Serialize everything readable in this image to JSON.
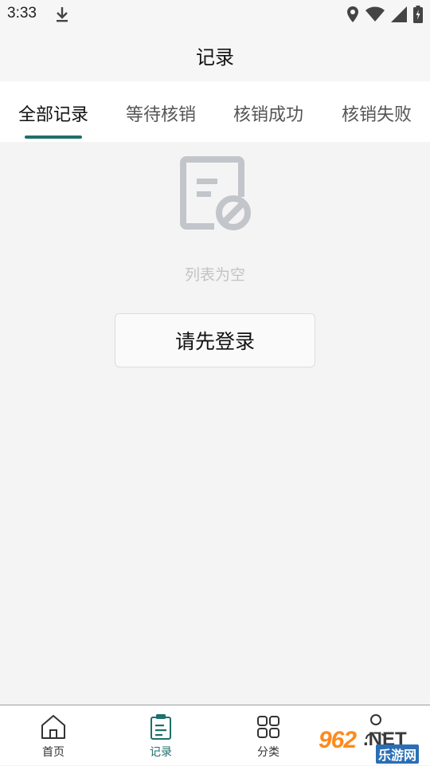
{
  "status_bar": {
    "time": "3:33"
  },
  "header": {
    "title": "记录"
  },
  "tabs": [
    {
      "label": "全部记录",
      "active": true
    },
    {
      "label": "等待核销",
      "active": false
    },
    {
      "label": "核销成功",
      "active": false
    },
    {
      "label": "核销失败",
      "active": false
    }
  ],
  "empty_state": {
    "text": "列表为空",
    "icon": "empty-document-icon"
  },
  "login_button": {
    "label": "请先登录"
  },
  "bottom_nav": [
    {
      "label": "首页",
      "icon": "home-icon",
      "active": false
    },
    {
      "label": "记录",
      "icon": "clipboard-icon",
      "active": true
    },
    {
      "label": "分类",
      "icon": "grid-icon",
      "active": false
    },
    {
      "label": "",
      "icon": "profile-icon",
      "active": false
    }
  ],
  "watermark": {
    "number": "962",
    "suffix": ".NET",
    "subtitle": "乐游网"
  },
  "colors": {
    "accent": "#1f6f6b",
    "background": "#f4f4f4"
  }
}
